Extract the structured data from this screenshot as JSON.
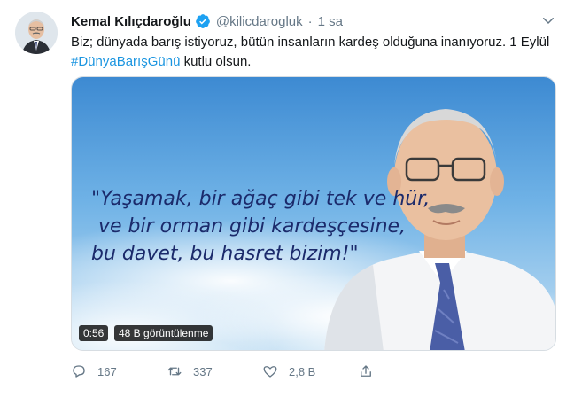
{
  "tweet": {
    "author_name": "Kemal Kılıçdaroğlu",
    "handle": "@kilicdarogluk",
    "separator": "·",
    "time": "1 sa",
    "text_prefix": "Biz; dünyada barış istiyoruz, bütün insanların kardeş olduğuna inanıyoruz. 1 Eylül ",
    "hashtag": "#DünyaBarışGünü",
    "text_suffix": " kutlu olsun."
  },
  "video": {
    "quote_lines": [
      "\"Yaşamak, bir ağaç gibi tek ve hür,",
      "ve bir orman gibi kardeşçesine,",
      "bu davet, bu hasret bizim!\""
    ],
    "duration": "0:56",
    "views": "48 B görüntülenme"
  },
  "actions": {
    "replies": "167",
    "retweets": "337",
    "likes": "2,8 B"
  },
  "colors": {
    "accent": "#1b95e0",
    "quote_text": "#1b2a6b",
    "muted": "#657786"
  },
  "icons": {
    "verified": "verified-badge-icon",
    "caret": "chevron-down-icon",
    "reply": "reply-icon",
    "retweet": "retweet-icon",
    "like": "heart-icon",
    "share": "share-icon"
  }
}
